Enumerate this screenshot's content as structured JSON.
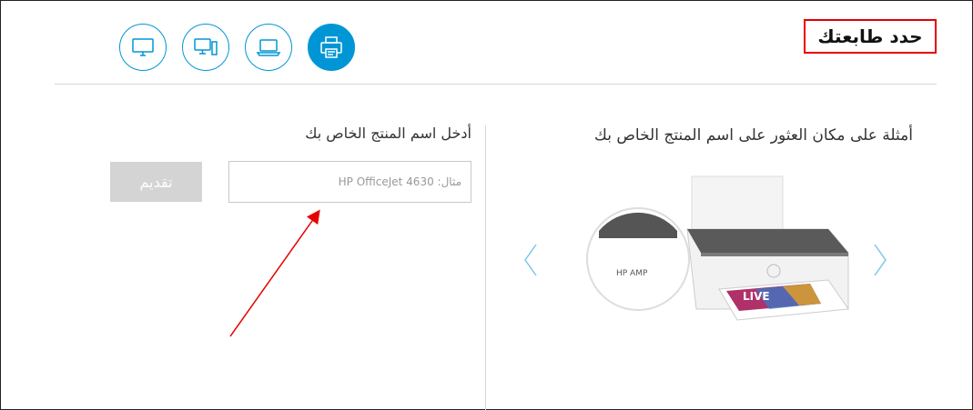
{
  "header": {
    "title": "حدد طابعتك",
    "device_icons": [
      {
        "name": "monitor-icon",
        "active": false
      },
      {
        "name": "desktop-tower-icon",
        "active": false
      },
      {
        "name": "laptop-icon",
        "active": false
      },
      {
        "name": "printer-icon",
        "active": true
      }
    ]
  },
  "examples": {
    "title": "أمثلة على مكان العثور على اسم المنتج الخاص بك",
    "zoom_label": "HP AMP",
    "prev_icon": "chevron-left-icon",
    "next_icon": "chevron-right-icon"
  },
  "product_entry": {
    "title": "أدخل اسم المنتج الخاص بك",
    "input_placeholder": "مثال: HP OfficeJet 4630",
    "input_value": "",
    "submit_label": "تقديم"
  },
  "colors": {
    "accent": "#0096d6",
    "highlight_border": "#e60000",
    "annotation_arrow": "#e60000",
    "disabled_button": "#d4d4d4"
  }
}
